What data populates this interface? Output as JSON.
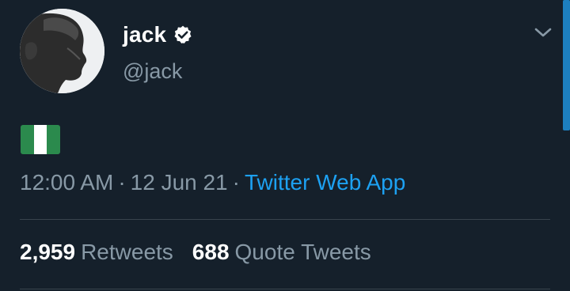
{
  "tweet": {
    "author": {
      "display_name": "jack",
      "handle": "@jack",
      "verified": true
    },
    "content": {
      "emoji": "nigeria-flag"
    },
    "meta": {
      "time": "12:00 AM",
      "separator": "·",
      "date": "12 Jun 21",
      "source": "Twitter Web App"
    },
    "stats": {
      "retweets_count": "2,959",
      "retweets_label": "Retweets",
      "quotes_count": "688",
      "quotes_label": "Quote Tweets"
    }
  },
  "colors": {
    "background": "#15202b",
    "primary_text": "#ffffff",
    "secondary_text": "#8899a6",
    "accent": "#1da1f2",
    "divider": "#38444d",
    "flag_green": "#2b8a4d"
  },
  "icons": {
    "verified": "verified-badge-icon",
    "menu": "chevron-down-icon"
  }
}
